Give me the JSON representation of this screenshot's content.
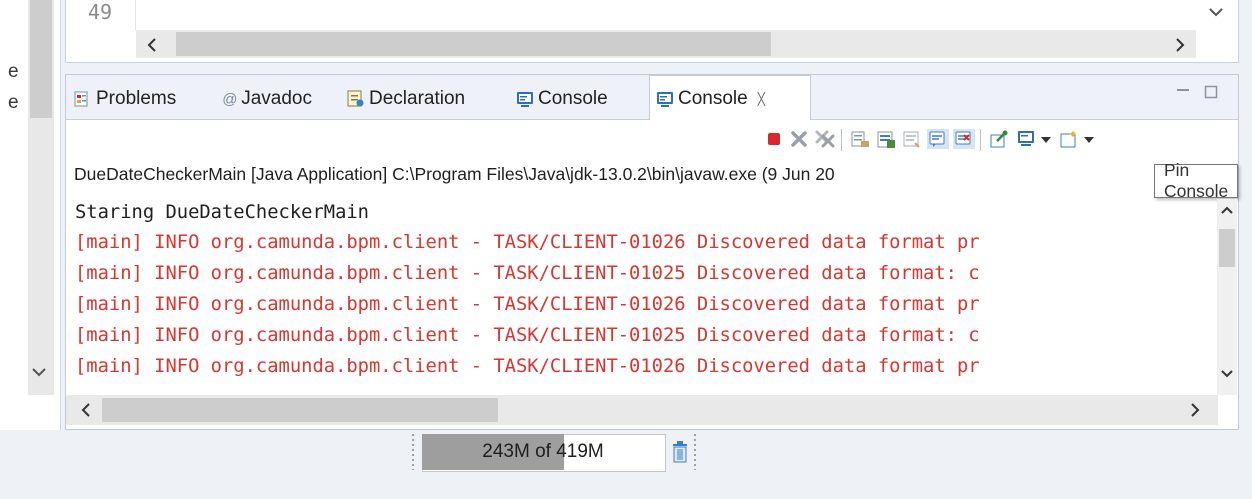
{
  "left_panel": {
    "letters": [
      "e",
      "e"
    ]
  },
  "editor": {
    "line_number": "49"
  },
  "tabs": [
    {
      "label": "Problems",
      "icon": "problems-icon"
    },
    {
      "label": "Javadoc",
      "icon": "at-icon"
    },
    {
      "label": "Declaration",
      "icon": "declaration-icon"
    },
    {
      "label": "Console",
      "icon": "console-icon"
    },
    {
      "label": "Console",
      "icon": "console-icon",
      "active": true,
      "close_glyph": "╳"
    }
  ],
  "toolbar_icons": [
    "terminate-icon",
    "remove-launch-icon",
    "remove-all-terminated-icon",
    "clear-console-icon",
    "scroll-lock-icon",
    "word-wrap-icon",
    "show-on-stdout-icon",
    "show-on-stderr-icon",
    "pin-console-icon",
    "display-selected-console-icon",
    "open-console-icon"
  ],
  "launch_info": "DueDateCheckerMain [Java Application] C:\\Program Files\\Java\\jdk-13.0.2\\bin\\javaw.exe (9 Jun 20",
  "tooltip": "Pin Console",
  "output_lines": [
    {
      "text": "Staring DueDateCheckerMain",
      "stream": "out"
    },
    {
      "text": "[main] INFO org.camunda.bpm.client - TASK/CLIENT-01026 Discovered data format pr",
      "stream": "err"
    },
    {
      "text": "[main] INFO org.camunda.bpm.client - TASK/CLIENT-01025 Discovered data format: c",
      "stream": "err"
    },
    {
      "text": "[main] INFO org.camunda.bpm.client - TASK/CLIENT-01026 Discovered data format pr",
      "stream": "err"
    },
    {
      "text": "[main] INFO org.camunda.bpm.client - TASK/CLIENT-01025 Discovered data format: c",
      "stream": "err"
    },
    {
      "text": "[main] INFO org.camunda.bpm.client - TASK/CLIENT-01026 Discovered data format pr",
      "stream": "err"
    }
  ],
  "heap": {
    "label": "243M of 419M",
    "used_fraction": 0.58
  },
  "colors": {
    "stderr": "#d83630",
    "accent": "#3c7fc6",
    "terminate": "#d9272b"
  }
}
